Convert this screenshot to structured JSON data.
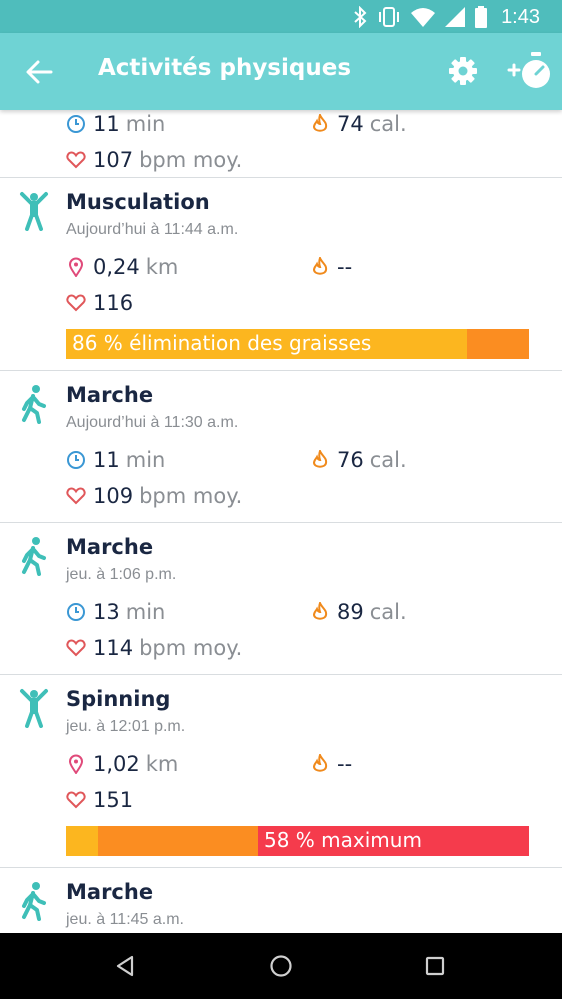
{
  "status_bar": {
    "time": "1:43",
    "icons": [
      "bluetooth-icon",
      "vibrate-icon",
      "wifi-icon",
      "signal-icon",
      "battery-icon"
    ]
  },
  "app_bar": {
    "title": "Activités physiques",
    "icons": [
      "back-arrow-icon",
      "gear-icon",
      "add-exercise-timer-icon"
    ]
  },
  "colors": {
    "status_bar": "#4fbdbc",
    "app_bar": "#6fd3d4",
    "teal_icon": "#3fbfb8",
    "clock_blue": "#3a97d4",
    "heart": "#e0575a",
    "pin": "#e04a7a",
    "flame": "#f08a1c",
    "zone_yellow": "#fcb61f",
    "zone_orange": "#fb8d21",
    "zone_red": "#f53b4c"
  },
  "activities": [
    {
      "name": "",
      "date": "",
      "icon": "walk-icon",
      "stat_left": {
        "icon": "clock-icon",
        "value": "11",
        "unit": "min"
      },
      "stat_right": {
        "icon": "flame-icon",
        "value": "74",
        "unit": "cal."
      },
      "heart": {
        "value": "107",
        "unit": "bpm moy."
      }
    },
    {
      "name": "Musculation",
      "date": "Aujourd’hui à 11:44 a.m.",
      "icon": "person-arms-up-icon",
      "stat_left": {
        "icon": "location-pin-icon",
        "value": "0,24",
        "unit": "km"
      },
      "stat_right": {
        "icon": "flame-icon",
        "value": "--",
        "unit": ""
      },
      "heart": {
        "value": "116",
        "unit": ""
      },
      "zone_bar": {
        "label": "86 % élimination des graisses",
        "segments": [
          {
            "color": "#fcb61f",
            "fraction": 0.866
          },
          {
            "color": "#fb8d21",
            "fraction": 0.134
          }
        ]
      }
    },
    {
      "name": "Marche",
      "date": "Aujourd’hui à 11:30 a.m.",
      "icon": "walk-icon",
      "stat_left": {
        "icon": "clock-icon",
        "value": "11",
        "unit": "min"
      },
      "stat_right": {
        "icon": "flame-icon",
        "value": "76",
        "unit": "cal."
      },
      "heart": {
        "value": "109",
        "unit": "bpm moy."
      }
    },
    {
      "name": "Marche",
      "date": "jeu. à 1:06 p.m.",
      "icon": "walk-icon",
      "stat_left": {
        "icon": "clock-icon",
        "value": "13",
        "unit": "min"
      },
      "stat_right": {
        "icon": "flame-icon",
        "value": "89",
        "unit": "cal."
      },
      "heart": {
        "value": "114",
        "unit": "bpm moy."
      }
    },
    {
      "name": "Spinning",
      "date": "jeu. à 12:01 p.m.",
      "icon": "person-arms-up-icon",
      "stat_left": {
        "icon": "location-pin-icon",
        "value": "1,02",
        "unit": "km"
      },
      "stat_right": {
        "icon": "flame-icon",
        "value": "--",
        "unit": ""
      },
      "heart": {
        "value": "151",
        "unit": ""
      },
      "zone_bar": {
        "label": "58 % maximum",
        "segments": [
          {
            "color": "#fcb61f",
            "fraction": 0.069
          },
          {
            "color": "#fb8d21",
            "fraction": 0.346
          },
          {
            "color": "#f53b4c",
            "fraction": 0.585
          }
        ]
      }
    },
    {
      "name": "Marche",
      "date": "jeu. à 11:45 a.m.",
      "icon": "walk-icon"
    }
  ],
  "nav_bar": {
    "icons": [
      "back-triangle-icon",
      "home-circle-icon",
      "recents-square-icon"
    ]
  }
}
